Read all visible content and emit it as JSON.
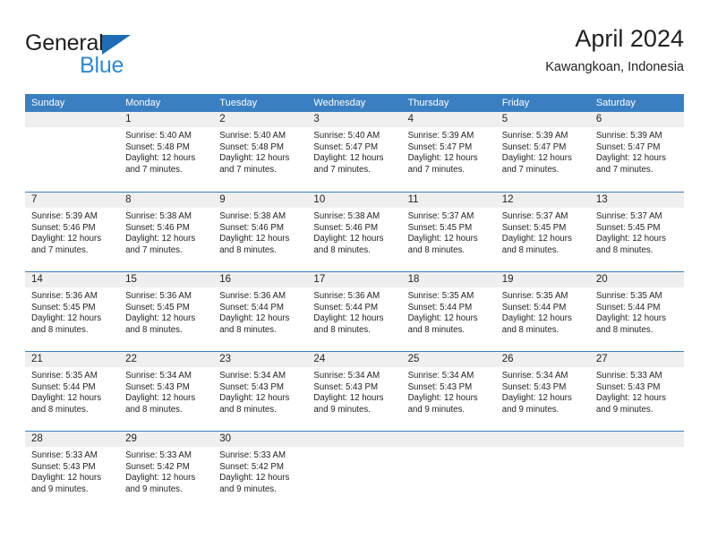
{
  "brand": {
    "name_part1": "General",
    "name_part2": "Blue",
    "triangle_color": "#1f6cb4",
    "blue_color": "#2e8bd4"
  },
  "header": {
    "title": "April 2024",
    "subtitle": "Kawangkoan, Indonesia"
  },
  "theme": {
    "header_bg": "#3a7fc1",
    "day_band_bg": "#efefef",
    "text_color": "#231f20"
  },
  "weekdays": [
    "Sunday",
    "Monday",
    "Tuesday",
    "Wednesday",
    "Thursday",
    "Friday",
    "Saturday"
  ],
  "weeks": [
    [
      {
        "day": "",
        "empty": true,
        "sunrise": "",
        "sunset": "",
        "daylight_l1": "",
        "daylight_l2": ""
      },
      {
        "day": "1",
        "sunrise": "Sunrise: 5:40 AM",
        "sunset": "Sunset: 5:48 PM",
        "daylight_l1": "Daylight: 12 hours",
        "daylight_l2": "and 7 minutes."
      },
      {
        "day": "2",
        "sunrise": "Sunrise: 5:40 AM",
        "sunset": "Sunset: 5:48 PM",
        "daylight_l1": "Daylight: 12 hours",
        "daylight_l2": "and 7 minutes."
      },
      {
        "day": "3",
        "sunrise": "Sunrise: 5:40 AM",
        "sunset": "Sunset: 5:47 PM",
        "daylight_l1": "Daylight: 12 hours",
        "daylight_l2": "and 7 minutes."
      },
      {
        "day": "4",
        "sunrise": "Sunrise: 5:39 AM",
        "sunset": "Sunset: 5:47 PM",
        "daylight_l1": "Daylight: 12 hours",
        "daylight_l2": "and 7 minutes."
      },
      {
        "day": "5",
        "sunrise": "Sunrise: 5:39 AM",
        "sunset": "Sunset: 5:47 PM",
        "daylight_l1": "Daylight: 12 hours",
        "daylight_l2": "and 7 minutes."
      },
      {
        "day": "6",
        "sunrise": "Sunrise: 5:39 AM",
        "sunset": "Sunset: 5:47 PM",
        "daylight_l1": "Daylight: 12 hours",
        "daylight_l2": "and 7 minutes."
      }
    ],
    [
      {
        "day": "7",
        "sunrise": "Sunrise: 5:39 AM",
        "sunset": "Sunset: 5:46 PM",
        "daylight_l1": "Daylight: 12 hours",
        "daylight_l2": "and 7 minutes."
      },
      {
        "day": "8",
        "sunrise": "Sunrise: 5:38 AM",
        "sunset": "Sunset: 5:46 PM",
        "daylight_l1": "Daylight: 12 hours",
        "daylight_l2": "and 7 minutes."
      },
      {
        "day": "9",
        "sunrise": "Sunrise: 5:38 AM",
        "sunset": "Sunset: 5:46 PM",
        "daylight_l1": "Daylight: 12 hours",
        "daylight_l2": "and 8 minutes."
      },
      {
        "day": "10",
        "sunrise": "Sunrise: 5:38 AM",
        "sunset": "Sunset: 5:46 PM",
        "daylight_l1": "Daylight: 12 hours",
        "daylight_l2": "and 8 minutes."
      },
      {
        "day": "11",
        "sunrise": "Sunrise: 5:37 AM",
        "sunset": "Sunset: 5:45 PM",
        "daylight_l1": "Daylight: 12 hours",
        "daylight_l2": "and 8 minutes."
      },
      {
        "day": "12",
        "sunrise": "Sunrise: 5:37 AM",
        "sunset": "Sunset: 5:45 PM",
        "daylight_l1": "Daylight: 12 hours",
        "daylight_l2": "and 8 minutes."
      },
      {
        "day": "13",
        "sunrise": "Sunrise: 5:37 AM",
        "sunset": "Sunset: 5:45 PM",
        "daylight_l1": "Daylight: 12 hours",
        "daylight_l2": "and 8 minutes."
      }
    ],
    [
      {
        "day": "14",
        "sunrise": "Sunrise: 5:36 AM",
        "sunset": "Sunset: 5:45 PM",
        "daylight_l1": "Daylight: 12 hours",
        "daylight_l2": "and 8 minutes."
      },
      {
        "day": "15",
        "sunrise": "Sunrise: 5:36 AM",
        "sunset": "Sunset: 5:45 PM",
        "daylight_l1": "Daylight: 12 hours",
        "daylight_l2": "and 8 minutes."
      },
      {
        "day": "16",
        "sunrise": "Sunrise: 5:36 AM",
        "sunset": "Sunset: 5:44 PM",
        "daylight_l1": "Daylight: 12 hours",
        "daylight_l2": "and 8 minutes."
      },
      {
        "day": "17",
        "sunrise": "Sunrise: 5:36 AM",
        "sunset": "Sunset: 5:44 PM",
        "daylight_l1": "Daylight: 12 hours",
        "daylight_l2": "and 8 minutes."
      },
      {
        "day": "18",
        "sunrise": "Sunrise: 5:35 AM",
        "sunset": "Sunset: 5:44 PM",
        "daylight_l1": "Daylight: 12 hours",
        "daylight_l2": "and 8 minutes."
      },
      {
        "day": "19",
        "sunrise": "Sunrise: 5:35 AM",
        "sunset": "Sunset: 5:44 PM",
        "daylight_l1": "Daylight: 12 hours",
        "daylight_l2": "and 8 minutes."
      },
      {
        "day": "20",
        "sunrise": "Sunrise: 5:35 AM",
        "sunset": "Sunset: 5:44 PM",
        "daylight_l1": "Daylight: 12 hours",
        "daylight_l2": "and 8 minutes."
      }
    ],
    [
      {
        "day": "21",
        "sunrise": "Sunrise: 5:35 AM",
        "sunset": "Sunset: 5:44 PM",
        "daylight_l1": "Daylight: 12 hours",
        "daylight_l2": "and 8 minutes."
      },
      {
        "day": "22",
        "sunrise": "Sunrise: 5:34 AM",
        "sunset": "Sunset: 5:43 PM",
        "daylight_l1": "Daylight: 12 hours",
        "daylight_l2": "and 8 minutes."
      },
      {
        "day": "23",
        "sunrise": "Sunrise: 5:34 AM",
        "sunset": "Sunset: 5:43 PM",
        "daylight_l1": "Daylight: 12 hours",
        "daylight_l2": "and 8 minutes."
      },
      {
        "day": "24",
        "sunrise": "Sunrise: 5:34 AM",
        "sunset": "Sunset: 5:43 PM",
        "daylight_l1": "Daylight: 12 hours",
        "daylight_l2": "and 9 minutes."
      },
      {
        "day": "25",
        "sunrise": "Sunrise: 5:34 AM",
        "sunset": "Sunset: 5:43 PM",
        "daylight_l1": "Daylight: 12 hours",
        "daylight_l2": "and 9 minutes."
      },
      {
        "day": "26",
        "sunrise": "Sunrise: 5:34 AM",
        "sunset": "Sunset: 5:43 PM",
        "daylight_l1": "Daylight: 12 hours",
        "daylight_l2": "and 9 minutes."
      },
      {
        "day": "27",
        "sunrise": "Sunrise: 5:33 AM",
        "sunset": "Sunset: 5:43 PM",
        "daylight_l1": "Daylight: 12 hours",
        "daylight_l2": "and 9 minutes."
      }
    ],
    [
      {
        "day": "28",
        "sunrise": "Sunrise: 5:33 AM",
        "sunset": "Sunset: 5:43 PM",
        "daylight_l1": "Daylight: 12 hours",
        "daylight_l2": "and 9 minutes."
      },
      {
        "day": "29",
        "sunrise": "Sunrise: 5:33 AM",
        "sunset": "Sunset: 5:42 PM",
        "daylight_l1": "Daylight: 12 hours",
        "daylight_l2": "and 9 minutes."
      },
      {
        "day": "30",
        "sunrise": "Sunrise: 5:33 AM",
        "sunset": "Sunset: 5:42 PM",
        "daylight_l1": "Daylight: 12 hours",
        "daylight_l2": "and 9 minutes."
      },
      {
        "day": "",
        "empty": true,
        "sunrise": "",
        "sunset": "",
        "daylight_l1": "",
        "daylight_l2": ""
      },
      {
        "day": "",
        "empty": true,
        "sunrise": "",
        "sunset": "",
        "daylight_l1": "",
        "daylight_l2": ""
      },
      {
        "day": "",
        "empty": true,
        "sunrise": "",
        "sunset": "",
        "daylight_l1": "",
        "daylight_l2": ""
      },
      {
        "day": "",
        "empty": true,
        "sunrise": "",
        "sunset": "",
        "daylight_l1": "",
        "daylight_l2": ""
      }
    ]
  ]
}
